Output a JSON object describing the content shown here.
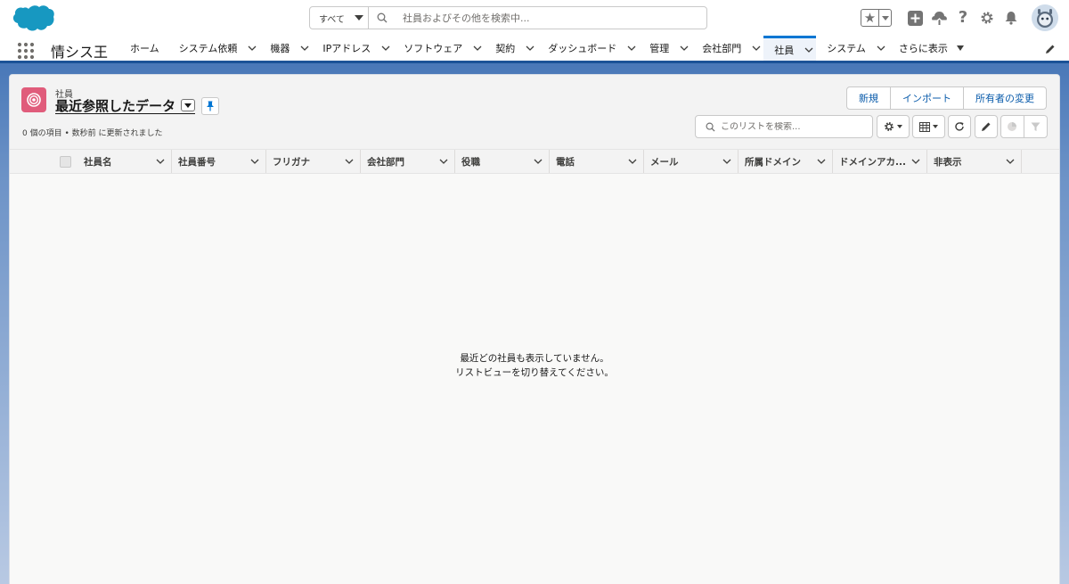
{
  "header": {
    "scope_label": "すべて",
    "search_placeholder": "社員およびその他を検索中..."
  },
  "nav": {
    "app_name": "情シス王",
    "items": [
      {
        "label": "ホーム",
        "has_menu": false
      },
      {
        "label": "システム依頼",
        "has_menu": true
      },
      {
        "label": "機器",
        "has_menu": true
      },
      {
        "label": "IPアドレス",
        "has_menu": true
      },
      {
        "label": "ソフトウェア",
        "has_menu": true
      },
      {
        "label": "契約",
        "has_menu": true
      },
      {
        "label": "ダッシュボード",
        "has_menu": true
      },
      {
        "label": "管理",
        "has_menu": true
      },
      {
        "label": "会社部門",
        "has_menu": true
      },
      {
        "label": "社員",
        "has_menu": true,
        "active": true
      },
      {
        "label": "システム",
        "has_menu": true
      }
    ],
    "more_label": "さらに表示"
  },
  "list": {
    "object_label": "社員",
    "view_name": "最近参照したデータ",
    "info": "0 個の項目 • 数秒前 に更新されました",
    "buttons": {
      "new": "新規",
      "import": "インポート",
      "change_owner": "所有者の変更"
    },
    "search_placeholder": "このリストを検索...",
    "columns": [
      "社員名",
      "社員番号",
      "フリガナ",
      "会社部門",
      "役職",
      "電話",
      "メール",
      "所属ドメイン",
      "ドメインアカ...",
      "非表示"
    ],
    "empty_line1": "最近どの社員も表示していません。",
    "empty_line2": "リストビューを切り替えてください。"
  },
  "colors": {
    "brand_blue": "#1b5297",
    "object_icon": "#e05c7b",
    "link_blue": "#0b5cab"
  }
}
